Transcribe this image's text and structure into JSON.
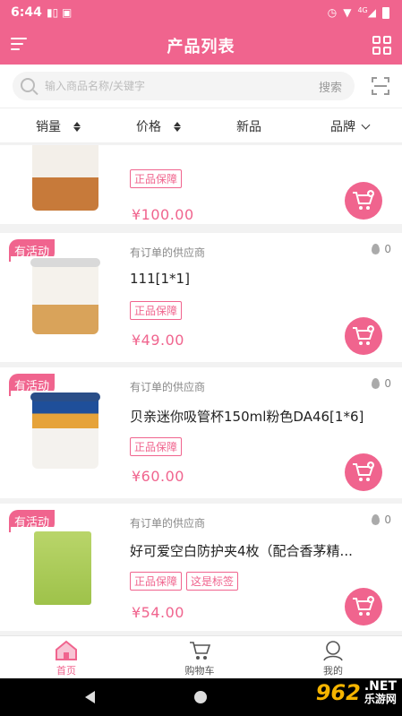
{
  "status_bar": {
    "time": "6:44",
    "network": "4G"
  },
  "header": {
    "title": "产品列表"
  },
  "search": {
    "placeholder": "输入商品名称/关键字",
    "button_label": "搜索"
  },
  "sort_bar": {
    "sales": "销量",
    "price": "价格",
    "new": "新品",
    "brand": "品牌"
  },
  "products": [
    {
      "promo": "",
      "supplier": "",
      "hot": "",
      "name": "",
      "tags": [
        "正品保障"
      ],
      "price": "¥100.00"
    },
    {
      "promo": "有活动",
      "supplier": "有订单的供应商",
      "hot": "0",
      "name": "111[1*1]",
      "tags": [
        "正品保障"
      ],
      "price": "¥49.00"
    },
    {
      "promo": "有活动",
      "supplier": "有订单的供应商",
      "hot": "0",
      "name": "贝亲迷你吸管杯150ml粉色DA46[1*6]",
      "tags": [
        "正品保障"
      ],
      "price": "¥60.00"
    },
    {
      "promo": "有活动",
      "supplier": "有订单的供应商",
      "hot": "0",
      "name": "好可爱空白防护夹4枚（配合香茅精...",
      "tags": [
        "正品保障",
        "这是标签"
      ],
      "price": "¥54.00"
    }
  ],
  "bottom_nav": {
    "home": "首页",
    "cart": "购物车",
    "mine": "我的"
  },
  "watermark": {
    "logo": "962",
    "suffix": ".NET",
    "sub": "乐游网"
  },
  "colors": {
    "accent": "#f0648e",
    "price": "#f0648e"
  }
}
